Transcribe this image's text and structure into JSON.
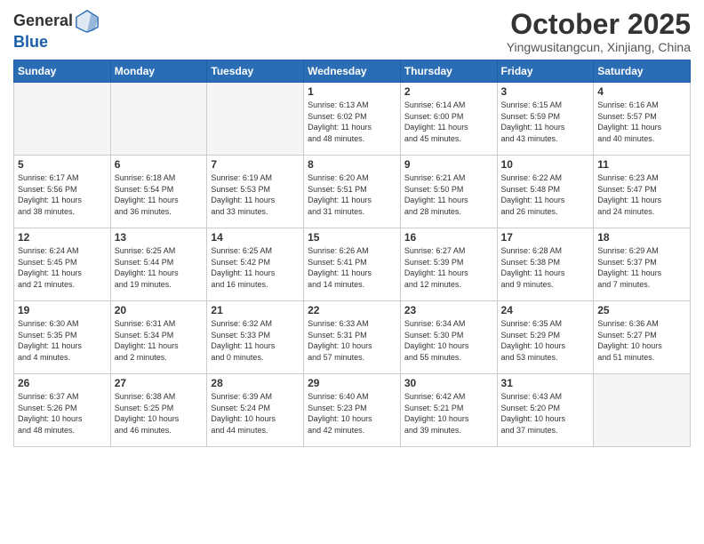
{
  "header": {
    "logo_line1": "General",
    "logo_line2": "Blue",
    "month_title": "October 2025",
    "location": "Yingwusitangcun, Xinjiang, China"
  },
  "weekdays": [
    "Sunday",
    "Monday",
    "Tuesday",
    "Wednesday",
    "Thursday",
    "Friday",
    "Saturday"
  ],
  "weeks": [
    [
      {
        "day": "",
        "info": ""
      },
      {
        "day": "",
        "info": ""
      },
      {
        "day": "",
        "info": ""
      },
      {
        "day": "1",
        "info": "Sunrise: 6:13 AM\nSunset: 6:02 PM\nDaylight: 11 hours\nand 48 minutes."
      },
      {
        "day": "2",
        "info": "Sunrise: 6:14 AM\nSunset: 6:00 PM\nDaylight: 11 hours\nand 45 minutes."
      },
      {
        "day": "3",
        "info": "Sunrise: 6:15 AM\nSunset: 5:59 PM\nDaylight: 11 hours\nand 43 minutes."
      },
      {
        "day": "4",
        "info": "Sunrise: 6:16 AM\nSunset: 5:57 PM\nDaylight: 11 hours\nand 40 minutes."
      }
    ],
    [
      {
        "day": "5",
        "info": "Sunrise: 6:17 AM\nSunset: 5:56 PM\nDaylight: 11 hours\nand 38 minutes."
      },
      {
        "day": "6",
        "info": "Sunrise: 6:18 AM\nSunset: 5:54 PM\nDaylight: 11 hours\nand 36 minutes."
      },
      {
        "day": "7",
        "info": "Sunrise: 6:19 AM\nSunset: 5:53 PM\nDaylight: 11 hours\nand 33 minutes."
      },
      {
        "day": "8",
        "info": "Sunrise: 6:20 AM\nSunset: 5:51 PM\nDaylight: 11 hours\nand 31 minutes."
      },
      {
        "day": "9",
        "info": "Sunrise: 6:21 AM\nSunset: 5:50 PM\nDaylight: 11 hours\nand 28 minutes."
      },
      {
        "day": "10",
        "info": "Sunrise: 6:22 AM\nSunset: 5:48 PM\nDaylight: 11 hours\nand 26 minutes."
      },
      {
        "day": "11",
        "info": "Sunrise: 6:23 AM\nSunset: 5:47 PM\nDaylight: 11 hours\nand 24 minutes."
      }
    ],
    [
      {
        "day": "12",
        "info": "Sunrise: 6:24 AM\nSunset: 5:45 PM\nDaylight: 11 hours\nand 21 minutes."
      },
      {
        "day": "13",
        "info": "Sunrise: 6:25 AM\nSunset: 5:44 PM\nDaylight: 11 hours\nand 19 minutes."
      },
      {
        "day": "14",
        "info": "Sunrise: 6:25 AM\nSunset: 5:42 PM\nDaylight: 11 hours\nand 16 minutes."
      },
      {
        "day": "15",
        "info": "Sunrise: 6:26 AM\nSunset: 5:41 PM\nDaylight: 11 hours\nand 14 minutes."
      },
      {
        "day": "16",
        "info": "Sunrise: 6:27 AM\nSunset: 5:39 PM\nDaylight: 11 hours\nand 12 minutes."
      },
      {
        "day": "17",
        "info": "Sunrise: 6:28 AM\nSunset: 5:38 PM\nDaylight: 11 hours\nand 9 minutes."
      },
      {
        "day": "18",
        "info": "Sunrise: 6:29 AM\nSunset: 5:37 PM\nDaylight: 11 hours\nand 7 minutes."
      }
    ],
    [
      {
        "day": "19",
        "info": "Sunrise: 6:30 AM\nSunset: 5:35 PM\nDaylight: 11 hours\nand 4 minutes."
      },
      {
        "day": "20",
        "info": "Sunrise: 6:31 AM\nSunset: 5:34 PM\nDaylight: 11 hours\nand 2 minutes."
      },
      {
        "day": "21",
        "info": "Sunrise: 6:32 AM\nSunset: 5:33 PM\nDaylight: 11 hours\nand 0 minutes."
      },
      {
        "day": "22",
        "info": "Sunrise: 6:33 AM\nSunset: 5:31 PM\nDaylight: 10 hours\nand 57 minutes."
      },
      {
        "day": "23",
        "info": "Sunrise: 6:34 AM\nSunset: 5:30 PM\nDaylight: 10 hours\nand 55 minutes."
      },
      {
        "day": "24",
        "info": "Sunrise: 6:35 AM\nSunset: 5:29 PM\nDaylight: 10 hours\nand 53 minutes."
      },
      {
        "day": "25",
        "info": "Sunrise: 6:36 AM\nSunset: 5:27 PM\nDaylight: 10 hours\nand 51 minutes."
      }
    ],
    [
      {
        "day": "26",
        "info": "Sunrise: 6:37 AM\nSunset: 5:26 PM\nDaylight: 10 hours\nand 48 minutes."
      },
      {
        "day": "27",
        "info": "Sunrise: 6:38 AM\nSunset: 5:25 PM\nDaylight: 10 hours\nand 46 minutes."
      },
      {
        "day": "28",
        "info": "Sunrise: 6:39 AM\nSunset: 5:24 PM\nDaylight: 10 hours\nand 44 minutes."
      },
      {
        "day": "29",
        "info": "Sunrise: 6:40 AM\nSunset: 5:23 PM\nDaylight: 10 hours\nand 42 minutes."
      },
      {
        "day": "30",
        "info": "Sunrise: 6:42 AM\nSunset: 5:21 PM\nDaylight: 10 hours\nand 39 minutes."
      },
      {
        "day": "31",
        "info": "Sunrise: 6:43 AM\nSunset: 5:20 PM\nDaylight: 10 hours\nand 37 minutes."
      },
      {
        "day": "",
        "info": ""
      }
    ]
  ]
}
